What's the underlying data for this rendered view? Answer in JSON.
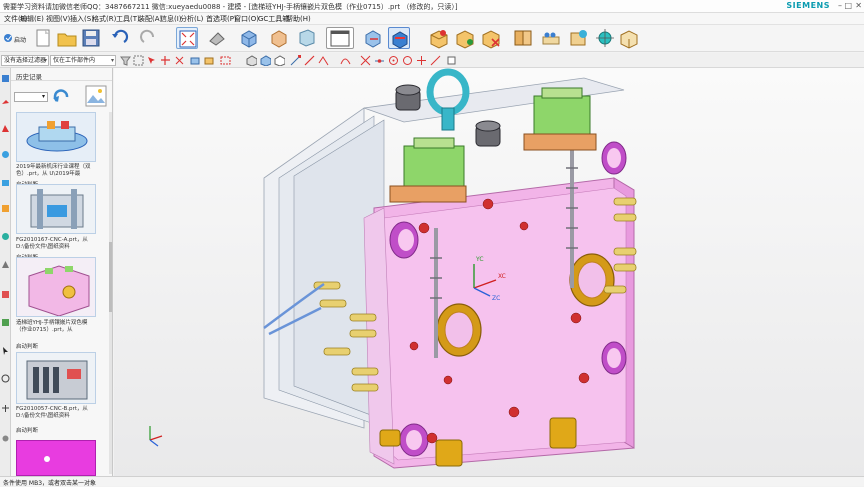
{
  "window": {
    "title": "需要学习资料请加微信老师QQ：3487667211 微信:xueyaedu0088 - 建模 - [造梯班YHJ-手柄镶嵌片双色模（作业0715）.prt （修改的，只读）]",
    "brand": "SIEMENS",
    "controls": [
      "–",
      "□",
      "✕"
    ]
  },
  "menu": {
    "items": [
      "文件(F)",
      "编辑(E)",
      "视图(V)",
      "插入(S)",
      "格式(R)",
      "工具(T)",
      "装配(A)",
      "信息(I)",
      "分析(L)",
      "首选项(P)",
      "窗口(O)",
      "GC工具箱",
      "帮助(H)"
    ]
  },
  "toolbar": {
    "start_label": "启动"
  },
  "selection_bar": {
    "filter_value": "没有选择过滤器",
    "scope_value": "仅在工作部件内",
    "filter_arrow": "▾",
    "scope_arrow": "▾"
  },
  "resource_bar": {
    "title": "历史记录",
    "items": [
      {
        "caption": "2019年最新机床行业课程（双色）.prt，从 U\\2019年最",
        "sub": "启动判断"
      },
      {
        "caption": "FG2010167-CNC-A.prt，从 D:\\备份文件\\图纸资料",
        "sub": "启动判断"
      },
      {
        "caption": "造梯班YHJ-手柄镶嵌片双色模（作业0715）.prt，从",
        "sub": "启动判断"
      },
      {
        "caption": "FG2010057-CNC-B.prt，从 D:\\备份文件\\图纸资料",
        "sub": "启动判断"
      }
    ]
  },
  "csys": {
    "yc": "YC",
    "xc": "XC",
    "zc": "ZC"
  },
  "status": {
    "text": "条件使用 MB3，或者双击某一对象"
  },
  "colors": {
    "plate_pink": "#f6b8ec",
    "plate_magenta": "#e07ad6",
    "gold": "#d8a21c",
    "eyebolt": "#38b6c8",
    "green_part": "#8ed66a",
    "orange_block": "#e8a064",
    "brand_teal": "#0a9bb0"
  }
}
